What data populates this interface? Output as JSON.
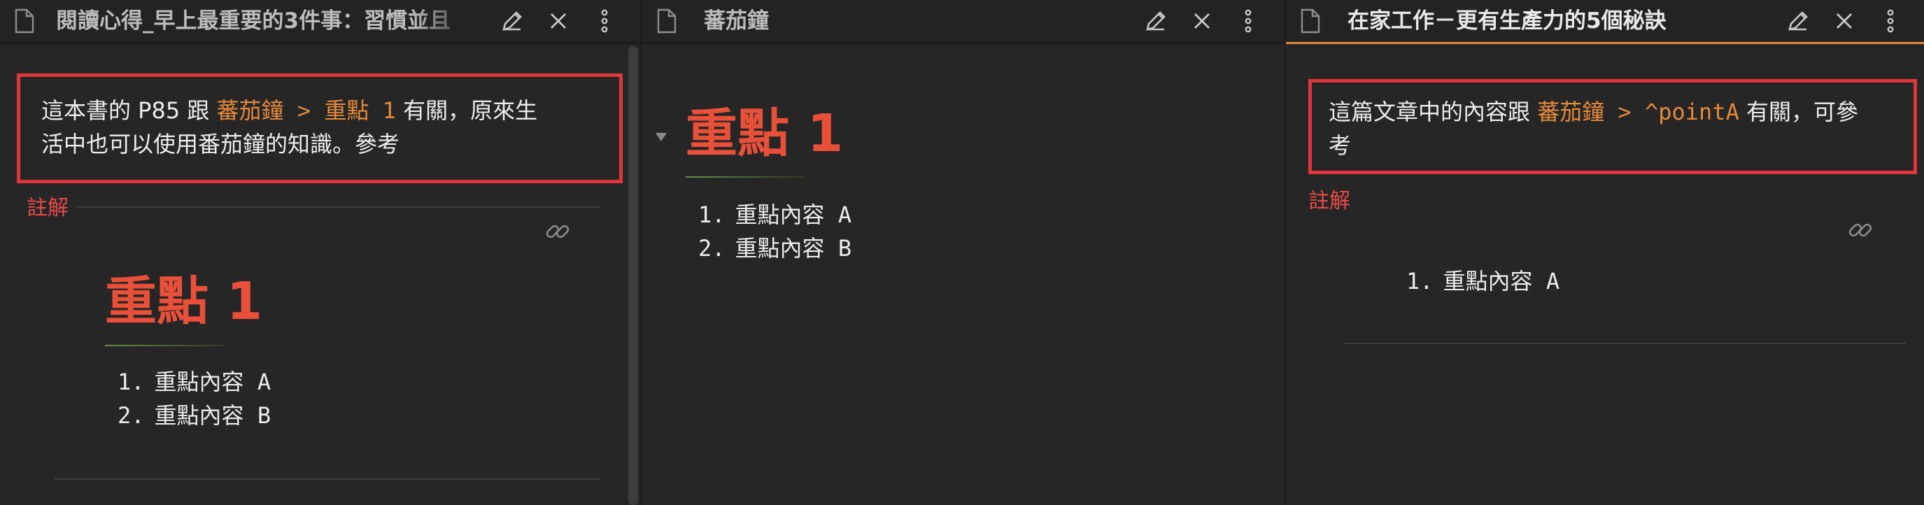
{
  "left_pane": {
    "title": "閱讀心得_早上最重要的3件事：習慣並且",
    "callout": {
      "prefix": "這本書的 P85 跟 ",
      "link": "蕃茄鐘 > 重點 1",
      "suffix_line1": " 有關，原來生",
      "line2": "活中也可以使用番茄鐘的知識。參考"
    },
    "note_label": "註解",
    "heading": "重點 1",
    "items": [
      {
        "num": "1.",
        "text": "重點內容",
        "suffix": " A"
      },
      {
        "num": "2.",
        "text": "重點內容",
        "suffix": " B"
      }
    ]
  },
  "middle_pane": {
    "title": "蕃茄鐘",
    "heading": "重點 1",
    "items": [
      {
        "num": "1.",
        "text": "重點內容",
        "suffix": " A"
      },
      {
        "num": "2.",
        "text": "重點內容",
        "suffix": " B"
      }
    ]
  },
  "right_pane": {
    "title": "在家工作－更有生產力的5個秘訣",
    "callout": {
      "prefix": "這篇文章中的內容跟 ",
      "link": "蕃茄鐘 > ^pointA",
      "suffix_line1": " 有關，可參",
      "line2": "考"
    },
    "note_label": "註解",
    "items": [
      {
        "num": "1.",
        "text": "重點內容",
        "suffix": " A"
      }
    ]
  },
  "icons": {
    "doc": "document-icon",
    "edit": "pencil-icon",
    "close": "close-icon",
    "more": "more-vertical-icon",
    "link": "link-icon",
    "collapse": "collapse-triangle-icon"
  },
  "colors": {
    "accent": "#e5893a",
    "heading": "#e8503a",
    "callout_border": "#e0363c",
    "note_label": "#e84a4a"
  }
}
